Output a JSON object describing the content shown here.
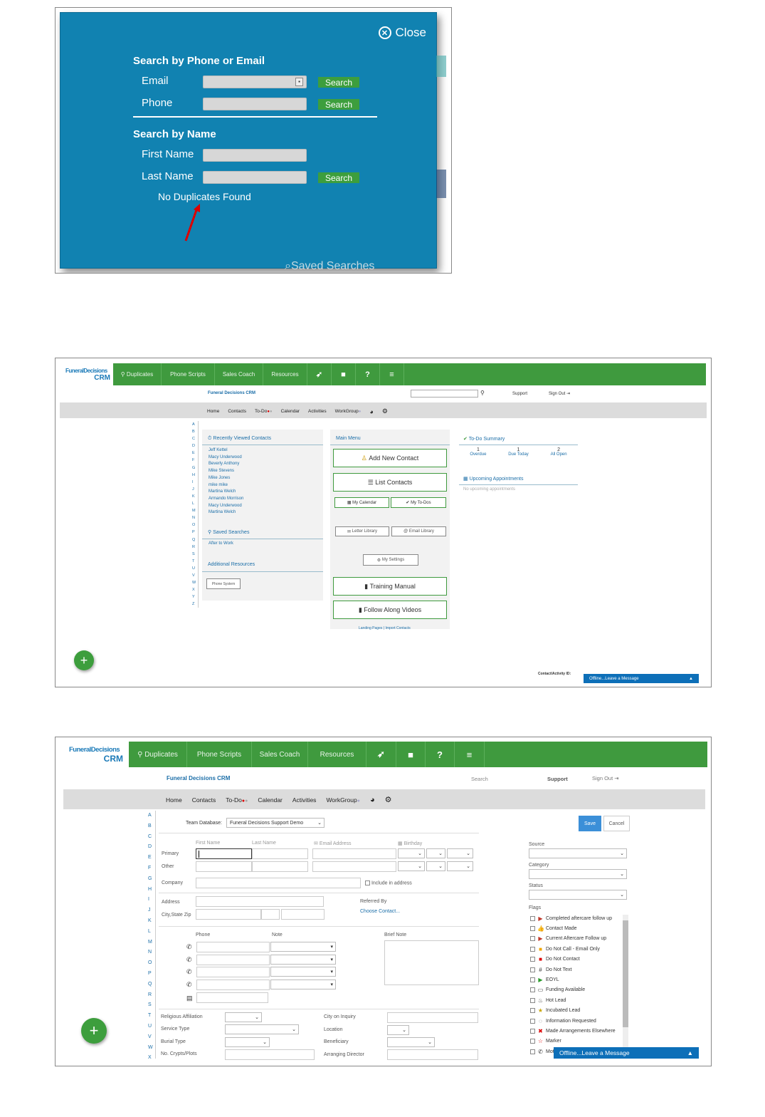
{
  "panel1": {
    "close_label": "Close",
    "heading_phone_email": "Search by Phone or Email",
    "email_label": "Email",
    "phone_label": "Phone",
    "search_label": "Search",
    "heading_name": "Search by Name",
    "first_name_label": "First Name",
    "last_name_label": "Last Name",
    "no_duplicates": "No Duplicates Found",
    "peek_text": "Saved Searches"
  },
  "nav": {
    "logo_top": "FuneralDecisions",
    "logo_bottom": "CRM",
    "items": [
      "Duplicates",
      "Phone Scripts",
      "Sales Coach",
      "Resources"
    ],
    "icons": [
      "rocket-icon",
      "note-icon",
      "help-icon",
      "menu-icon"
    ],
    "app_title": "Funeral Decisions CRM",
    "support": "Support",
    "sign_out": "Sign Out",
    "search_placeholder": "Search",
    "subnav": [
      "Home",
      "Contacts",
      "To-Do",
      "Calendar",
      "Activities",
      "WorkGroup"
    ]
  },
  "alphabet": [
    "A",
    "B",
    "C",
    "D",
    "E",
    "F",
    "G",
    "H",
    "I",
    "J",
    "K",
    "L",
    "M",
    "N",
    "O",
    "P",
    "Q",
    "R",
    "S",
    "T",
    "U",
    "V",
    "W",
    "X",
    "Y",
    "Z"
  ],
  "panel2": {
    "recent_title": "Recently Viewed Contacts",
    "recent": [
      "Jeff Kettel",
      "Macy Underwood",
      "Beverly Anthony",
      "Mike Stevens",
      "Mike Jones",
      "mike mike",
      "Martina Welch",
      "Armando Morrison",
      "Macy Underwood",
      "Martina Welch"
    ],
    "saved_title": "Saved Searches",
    "saved": [
      "After to Work"
    ],
    "additional_title": "Additional Resources",
    "additional_btn": "Phone System",
    "main_menu": "Main Menu",
    "add_contact": "Add New Contact",
    "list_contacts": "List Contacts",
    "my_calendar": "My Calendar",
    "my_todos": "My To-Dos",
    "letter_library": "Letter Library",
    "email_library": "Email Library",
    "my_settings": "My Settings",
    "training_manual": "Training Manual",
    "follow_along": "Follow Along Videos",
    "landing_pages": "Landing Pages",
    "import_contacts": "Import Contacts",
    "todo_title": "To-Do Summary",
    "todo": [
      {
        "count": "1",
        "label": "Overdue"
      },
      {
        "count": "1",
        "label": "Due Today"
      },
      {
        "count": "2",
        "label": "All Open"
      }
    ],
    "appt_title": "Upcoming Appointments",
    "appt_none": "No upcoming appointments",
    "contact_id": "Contact/Activity ID:",
    "offline": "Offline...Leave a Message"
  },
  "panel3": {
    "team_db_label": "Team Database:",
    "team_db_value": "Funeral Decisions Support Demo",
    "save": "Save",
    "cancel": "Cancel",
    "first_name": "First Name",
    "last_name": "Last Name",
    "email": "Email Address",
    "birthday": "Birthday",
    "primary": "Primary",
    "other": "Other",
    "company": "Company",
    "include_address": "Include in address",
    "address": "Address",
    "city_state_zip": "City,State Zip",
    "referred_by": "Referred By",
    "choose_contact": "Choose Contact...",
    "phone": "Phone",
    "note": "Note",
    "brief_note": "Brief Note",
    "religious": "Religious Affiliation",
    "service_type": "Service Type",
    "burial_type": "Burial Type",
    "crypts": "No. Crypts/Plots",
    "city_inquiry": "City on Inquiry",
    "location": "Location",
    "beneficiary": "Beneficiary",
    "arranging": "Arranging Director",
    "source": "Source",
    "category": "Category",
    "status": "Status",
    "flags_title": "Flags",
    "flags": [
      {
        "label": "Completed aftercare follow up",
        "icon": "red-flag-icon",
        "color": "#c0392b"
      },
      {
        "label": "Contact Made",
        "icon": "thumb-icon",
        "color": "#333"
      },
      {
        "label": "Current Aftercare Follow up",
        "icon": "red-flag-icon",
        "color": "#c0392b"
      },
      {
        "label": "Do Not Call - Email Only",
        "icon": "orange-square-icon",
        "color": "#f0a500"
      },
      {
        "label": "Do Not Contact",
        "icon": "red-square-icon",
        "color": "#d00"
      },
      {
        "label": "Do Not Text",
        "icon": "hash-icon",
        "color": "#333"
      },
      {
        "label": "EOYL",
        "icon": "green-flag-icon",
        "color": "#2a9a2a"
      },
      {
        "label": "Funding Available",
        "icon": "money-icon",
        "color": "#333"
      },
      {
        "label": "Hot Lead",
        "icon": "fire-icon",
        "color": "#333"
      },
      {
        "label": "Incubated Lead",
        "icon": "star-icon",
        "color": "#c9a400"
      },
      {
        "label": "Information Requested",
        "icon": "chat-icon",
        "color": "#333"
      },
      {
        "label": "Made Arrangements Elsewhere",
        "icon": "x-icon",
        "color": "#d00"
      },
      {
        "label": "Marker",
        "icon": "star-outline-icon",
        "color": "#d00"
      },
      {
        "label": "Mot",
        "icon": "phone-icon",
        "color": "#333"
      }
    ],
    "offline": "Offline...Leave a Message"
  }
}
